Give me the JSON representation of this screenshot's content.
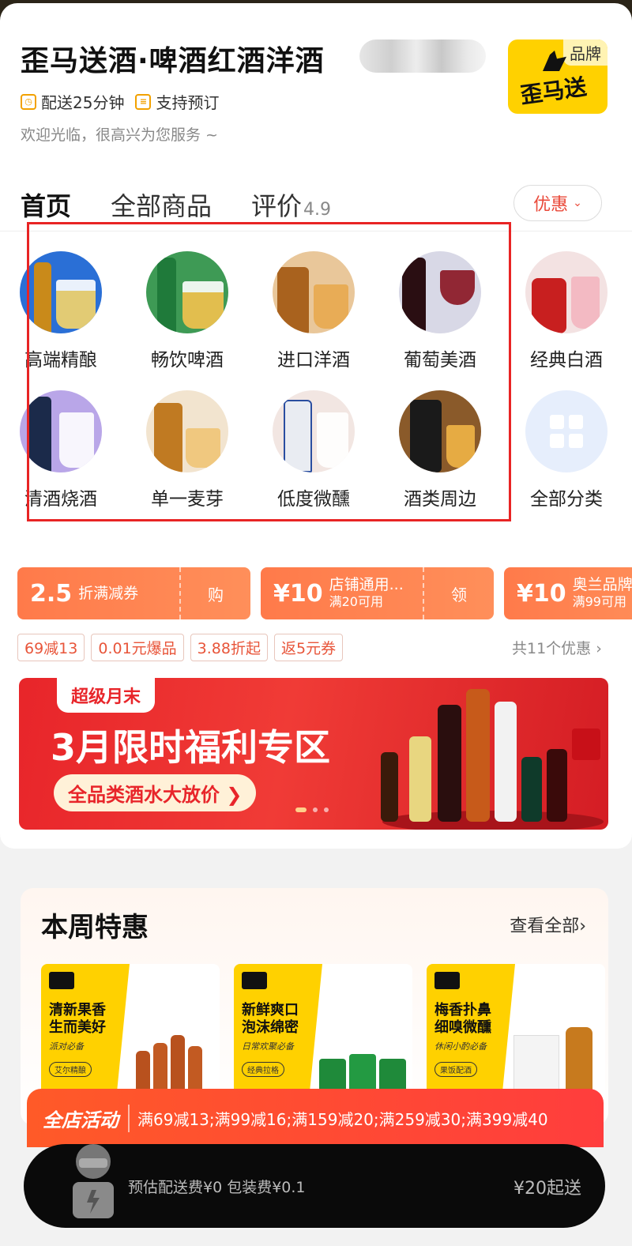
{
  "shop": {
    "title": "歪马送酒·啤酒红酒洋酒",
    "brand_tag": "品牌",
    "brand_logo_text": "歪马送酒",
    "delivery": "配送25分钟",
    "preorder": "支持预订",
    "welcome": "欢迎光临，很高兴为您服务 ~"
  },
  "tabs": {
    "home": "首页",
    "all": "全部商品",
    "reviews": "评价",
    "rating": "4.9",
    "promo": "优惠"
  },
  "categories": [
    {
      "label": "高端精酿",
      "icon": "craft-beer-icon"
    },
    {
      "label": "畅饮啤酒",
      "icon": "beer-icon"
    },
    {
      "label": "进口洋酒",
      "icon": "whisky-icon"
    },
    {
      "label": "葡萄美酒",
      "icon": "wine-icon"
    },
    {
      "label": "经典白酒",
      "icon": "baijiu-icon"
    },
    {
      "label": "清酒烧酒",
      "icon": "sake-icon"
    },
    {
      "label": "单一麦芽",
      "icon": "single-malt-icon"
    },
    {
      "label": "低度微醺",
      "icon": "low-alcohol-icon"
    },
    {
      "label": "酒类周边",
      "icon": "accessories-icon"
    },
    {
      "label": "全部分类",
      "icon": "grid-icon"
    }
  ],
  "coupons": [
    {
      "big": "2.5",
      "desc": "折满减券",
      "sub": "",
      "action": "购"
    },
    {
      "big": "¥10",
      "desc": "店铺通用...",
      "sub": "满20可用",
      "action": "领"
    },
    {
      "big": "¥10",
      "desc": "奥兰品牌",
      "sub": "满99可用",
      "action": ""
    }
  ],
  "tags": [
    "69减13",
    "0.01元爆品",
    "3.88折起",
    "返5元券"
  ],
  "total_promos": "共11个优惠 ›",
  "banner": {
    "tag": "超级月末",
    "title": "3月限时福利专区",
    "sub": "全品类酒水大放价 ❯"
  },
  "weekly": {
    "title": "本周特惠",
    "more": "查看全部›",
    "deals": [
      {
        "l1": "清新果香",
        "l2": "生而美好",
        "sub": "派对必备",
        "badge": "艾尔精酿"
      },
      {
        "l1": "新鲜爽口",
        "l2": "泡沫绵密",
        "sub": "日常欢聚必备",
        "badge": "经典拉格"
      },
      {
        "l1": "梅香扑鼻",
        "l2": "细嗅微醺",
        "sub": "休闲小酌必备",
        "badge": "果饭配酒"
      }
    ]
  },
  "store_activity": {
    "label": "全店活动",
    "text": "满69减13;满99减16;满159减20;满259减30;满399减40"
  },
  "cart": {
    "fee": "预估配送费¥0 包装费¥0.1",
    "min_order": "¥20起送"
  },
  "colors": {
    "accent": "#ffd100",
    "coupon": "#ff7a4a",
    "banner": "#e8252a",
    "highlight": "#e82424"
  }
}
